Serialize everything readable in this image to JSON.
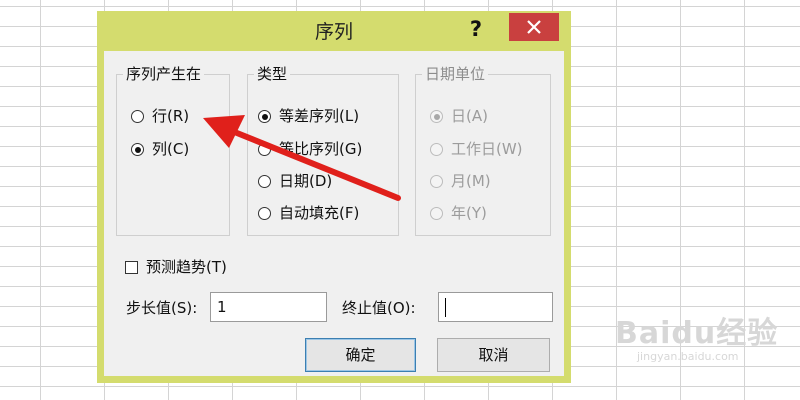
{
  "dialog": {
    "title": "序列",
    "help_label": "?",
    "close_icon": "close-icon"
  },
  "series_in": {
    "title": "序列产生在",
    "options": [
      {
        "label": "行(R)",
        "checked": false
      },
      {
        "label": "列(C)",
        "checked": true
      }
    ]
  },
  "type": {
    "title": "类型",
    "options": [
      {
        "label": "等差序列(L)",
        "checked": true
      },
      {
        "label": "等比序列(G)",
        "checked": false
      },
      {
        "label": "日期(D)",
        "checked": false
      },
      {
        "label": "自动填充(F)",
        "checked": false
      }
    ]
  },
  "date_unit": {
    "title": "日期单位",
    "disabled": true,
    "options": [
      {
        "label": "日(A)",
        "checked": true
      },
      {
        "label": "工作日(W)",
        "checked": false
      },
      {
        "label": "月(M)",
        "checked": false
      },
      {
        "label": "年(Y)",
        "checked": false
      }
    ]
  },
  "trend": {
    "label": "预测趋势(T)",
    "checked": false
  },
  "step": {
    "label": "步长值(S):",
    "value": "1"
  },
  "stop": {
    "label": "终止值(O):",
    "value": ""
  },
  "buttons": {
    "ok": "确定",
    "cancel": "取消"
  },
  "watermark": {
    "line1": "Baidu经验",
    "line2": "jingyan.baidu.com"
  },
  "colors": {
    "dialog_frame": "#d4dc6e",
    "close_button": "#c9403f",
    "arrow": "#e0201b"
  }
}
